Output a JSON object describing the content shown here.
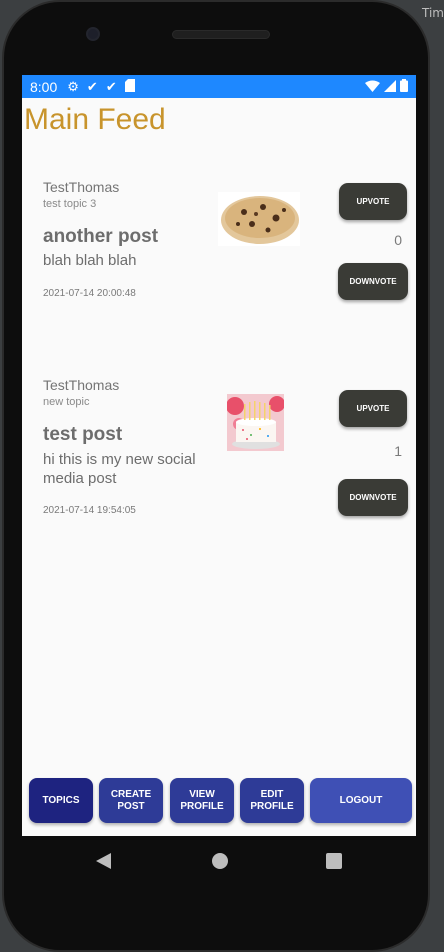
{
  "corner_label": "Tim",
  "status_bar": {
    "time": "8:00",
    "icons": [
      "gear-icon",
      "check-icon",
      "check-icon",
      "sd-card-icon"
    ],
    "right_icons": [
      "wifi-icon",
      "signal-icon",
      "battery-icon"
    ],
    "color": "#1e88ff"
  },
  "page": {
    "title": "Main Feed",
    "title_color": "#c8942c"
  },
  "posts": [
    {
      "author": "TestThomas",
      "topic": "test topic 3",
      "title": "another post",
      "body": "blah blah blah",
      "timestamp": "2021-07-14 20:00:48",
      "image": "cookie-image",
      "upvote_label": "UPVOTE",
      "downvote_label": "DOWNVOTE",
      "count": "0"
    },
    {
      "author": "TestThomas",
      "topic": "new topic",
      "title": "test post",
      "body": "hi this is my new social media post",
      "timestamp": "2021-07-14 19:54:05",
      "image": "birthday-cake-image",
      "upvote_label": "UPVOTE",
      "downvote_label": "DOWNVOTE",
      "count": "1"
    }
  ],
  "bottom_nav": [
    {
      "label": "TOPICS"
    },
    {
      "label": "CREATE\nPOST"
    },
    {
      "label": "VIEW\nPROFILE"
    },
    {
      "label": "EDIT\nPROFILE"
    },
    {
      "label": "LOGOUT"
    }
  ],
  "system_nav": [
    "back-icon",
    "home-icon",
    "recents-icon"
  ]
}
